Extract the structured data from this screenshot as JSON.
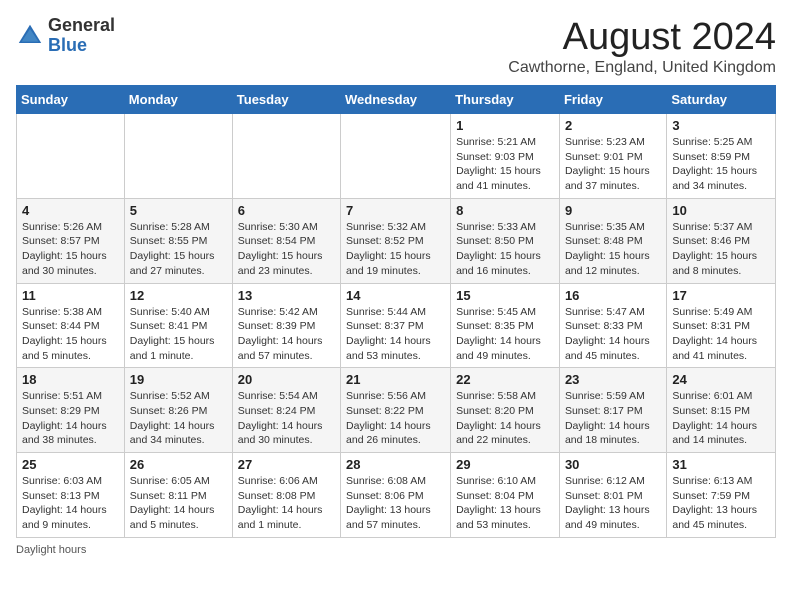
{
  "header": {
    "logo_general": "General",
    "logo_blue": "Blue",
    "month_title": "August 2024",
    "location": "Cawthorne, England, United Kingdom"
  },
  "days_of_week": [
    "Sunday",
    "Monday",
    "Tuesday",
    "Wednesday",
    "Thursday",
    "Friday",
    "Saturday"
  ],
  "weeks": [
    [
      {
        "day": "",
        "info": ""
      },
      {
        "day": "",
        "info": ""
      },
      {
        "day": "",
        "info": ""
      },
      {
        "day": "",
        "info": ""
      },
      {
        "day": "1",
        "info": "Sunrise: 5:21 AM\nSunset: 9:03 PM\nDaylight: 15 hours\nand 41 minutes."
      },
      {
        "day": "2",
        "info": "Sunrise: 5:23 AM\nSunset: 9:01 PM\nDaylight: 15 hours\nand 37 minutes."
      },
      {
        "day": "3",
        "info": "Sunrise: 5:25 AM\nSunset: 8:59 PM\nDaylight: 15 hours\nand 34 minutes."
      }
    ],
    [
      {
        "day": "4",
        "info": "Sunrise: 5:26 AM\nSunset: 8:57 PM\nDaylight: 15 hours\nand 30 minutes."
      },
      {
        "day": "5",
        "info": "Sunrise: 5:28 AM\nSunset: 8:55 PM\nDaylight: 15 hours\nand 27 minutes."
      },
      {
        "day": "6",
        "info": "Sunrise: 5:30 AM\nSunset: 8:54 PM\nDaylight: 15 hours\nand 23 minutes."
      },
      {
        "day": "7",
        "info": "Sunrise: 5:32 AM\nSunset: 8:52 PM\nDaylight: 15 hours\nand 19 minutes."
      },
      {
        "day": "8",
        "info": "Sunrise: 5:33 AM\nSunset: 8:50 PM\nDaylight: 15 hours\nand 16 minutes."
      },
      {
        "day": "9",
        "info": "Sunrise: 5:35 AM\nSunset: 8:48 PM\nDaylight: 15 hours\nand 12 minutes."
      },
      {
        "day": "10",
        "info": "Sunrise: 5:37 AM\nSunset: 8:46 PM\nDaylight: 15 hours\nand 8 minutes."
      }
    ],
    [
      {
        "day": "11",
        "info": "Sunrise: 5:38 AM\nSunset: 8:44 PM\nDaylight: 15 hours\nand 5 minutes."
      },
      {
        "day": "12",
        "info": "Sunrise: 5:40 AM\nSunset: 8:41 PM\nDaylight: 15 hours\nand 1 minute."
      },
      {
        "day": "13",
        "info": "Sunrise: 5:42 AM\nSunset: 8:39 PM\nDaylight: 14 hours\nand 57 minutes."
      },
      {
        "day": "14",
        "info": "Sunrise: 5:44 AM\nSunset: 8:37 PM\nDaylight: 14 hours\nand 53 minutes."
      },
      {
        "day": "15",
        "info": "Sunrise: 5:45 AM\nSunset: 8:35 PM\nDaylight: 14 hours\nand 49 minutes."
      },
      {
        "day": "16",
        "info": "Sunrise: 5:47 AM\nSunset: 8:33 PM\nDaylight: 14 hours\nand 45 minutes."
      },
      {
        "day": "17",
        "info": "Sunrise: 5:49 AM\nSunset: 8:31 PM\nDaylight: 14 hours\nand 41 minutes."
      }
    ],
    [
      {
        "day": "18",
        "info": "Sunrise: 5:51 AM\nSunset: 8:29 PM\nDaylight: 14 hours\nand 38 minutes."
      },
      {
        "day": "19",
        "info": "Sunrise: 5:52 AM\nSunset: 8:26 PM\nDaylight: 14 hours\nand 34 minutes."
      },
      {
        "day": "20",
        "info": "Sunrise: 5:54 AM\nSunset: 8:24 PM\nDaylight: 14 hours\nand 30 minutes."
      },
      {
        "day": "21",
        "info": "Sunrise: 5:56 AM\nSunset: 8:22 PM\nDaylight: 14 hours\nand 26 minutes."
      },
      {
        "day": "22",
        "info": "Sunrise: 5:58 AM\nSunset: 8:20 PM\nDaylight: 14 hours\nand 22 minutes."
      },
      {
        "day": "23",
        "info": "Sunrise: 5:59 AM\nSunset: 8:17 PM\nDaylight: 14 hours\nand 18 minutes."
      },
      {
        "day": "24",
        "info": "Sunrise: 6:01 AM\nSunset: 8:15 PM\nDaylight: 14 hours\nand 14 minutes."
      }
    ],
    [
      {
        "day": "25",
        "info": "Sunrise: 6:03 AM\nSunset: 8:13 PM\nDaylight: 14 hours\nand 9 minutes."
      },
      {
        "day": "26",
        "info": "Sunrise: 6:05 AM\nSunset: 8:11 PM\nDaylight: 14 hours\nand 5 minutes."
      },
      {
        "day": "27",
        "info": "Sunrise: 6:06 AM\nSunset: 8:08 PM\nDaylight: 14 hours\nand 1 minute."
      },
      {
        "day": "28",
        "info": "Sunrise: 6:08 AM\nSunset: 8:06 PM\nDaylight: 13 hours\nand 57 minutes."
      },
      {
        "day": "29",
        "info": "Sunrise: 6:10 AM\nSunset: 8:04 PM\nDaylight: 13 hours\nand 53 minutes."
      },
      {
        "day": "30",
        "info": "Sunrise: 6:12 AM\nSunset: 8:01 PM\nDaylight: 13 hours\nand 49 minutes."
      },
      {
        "day": "31",
        "info": "Sunrise: 6:13 AM\nSunset: 7:59 PM\nDaylight: 13 hours\nand 45 minutes."
      }
    ]
  ],
  "footer": {
    "daylight_label": "Daylight hours"
  }
}
